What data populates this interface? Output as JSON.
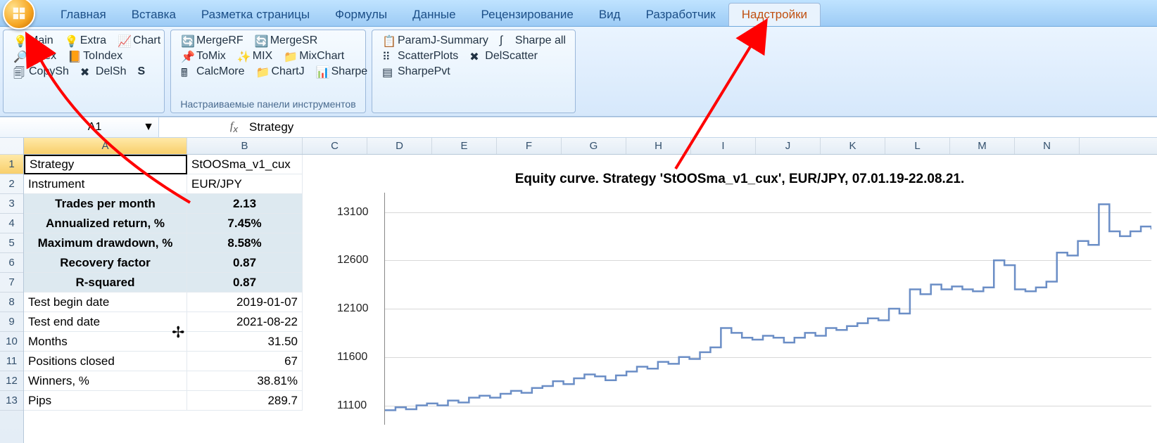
{
  "tabs": [
    "Главная",
    "Вставка",
    "Разметка страницы",
    "Формулы",
    "Данные",
    "Рецензирование",
    "Вид",
    "Разработчик",
    "Надстройки"
  ],
  "active_tab": 8,
  "ribbon": {
    "group1": {
      "items": [
        [
          "Main",
          "Extra",
          "Chart"
        ],
        [
          "Index",
          "ToIndex",
          ""
        ],
        [
          "CopySh",
          "DelSh",
          "S"
        ]
      ]
    },
    "group2": {
      "items": [
        [
          "MergeRF",
          "MergeSR",
          ""
        ],
        [
          "ToMix",
          "MIX",
          "MixChart"
        ],
        [
          "CalcMore",
          "ChartJ",
          "Sharpe"
        ]
      ]
    },
    "group3": {
      "items": [
        [
          "ParamJ-Summary",
          "Sharpe all"
        ],
        [
          "ScatterPlots",
          "DelScatter"
        ],
        [
          "SharpePvt",
          ""
        ]
      ]
    },
    "title": "Настраиваемые панели инструментов"
  },
  "namebox": "A1",
  "formula": "Strategy",
  "columns": [
    "A",
    "B",
    "C",
    "D",
    "E",
    "F",
    "G",
    "H",
    "I",
    "J",
    "K",
    "L",
    "M",
    "N"
  ],
  "rows": [
    {
      "a": "Strategy",
      "b": "StOOSma_v1_cux",
      "hl": false,
      "ra": false
    },
    {
      "a": "Instrument",
      "b": "EUR/JPY",
      "hl": false,
      "ra": false
    },
    {
      "a": "Trades per month",
      "b": "2.13",
      "hl": true
    },
    {
      "a": "Annualized return, %",
      "b": "7.45%",
      "hl": true
    },
    {
      "a": "Maximum drawdown, %",
      "b": "8.58%",
      "hl": true
    },
    {
      "a": "Recovery factor",
      "b": "0.87",
      "hl": true
    },
    {
      "a": "R-squared",
      "b": "0.87",
      "hl": true
    },
    {
      "a": "Test begin date",
      "b": "2019-01-07",
      "hl": false,
      "ra": true
    },
    {
      "a": "Test end date",
      "b": "2021-08-22",
      "hl": false,
      "ra": true
    },
    {
      "a": "Months",
      "b": "31.50",
      "hl": false,
      "ra": true
    },
    {
      "a": "Positions closed",
      "b": "67",
      "hl": false,
      "ra": true
    },
    {
      "a": "Winners, %",
      "b": "38.81%",
      "hl": false,
      "ra": true
    },
    {
      "a": "Pips",
      "b": "289.7",
      "hl": false,
      "ra": true
    }
  ],
  "chart_data": {
    "type": "line",
    "title": "Equity curve. Strategy 'StOOSma_v1_cux', EUR/JPY, 07.01.19-22.08.21.",
    "ylabel": "",
    "yticks": [
      11100,
      11600,
      12100,
      12600,
      13100
    ],
    "ylim": [
      10900,
      13300
    ],
    "x_range": [
      "2019-01-07",
      "2021-08-22"
    ],
    "values": [
      11050,
      11080,
      11060,
      11100,
      11120,
      11100,
      11150,
      11130,
      11180,
      11200,
      11180,
      11220,
      11250,
      11230,
      11280,
      11300,
      11350,
      11320,
      11380,
      11420,
      11400,
      11360,
      11410,
      11450,
      11500,
      11480,
      11550,
      11530,
      11600,
      11580,
      11650,
      11700,
      11900,
      11850,
      11800,
      11780,
      11820,
      11800,
      11750,
      11800,
      11850,
      11820,
      11900,
      11880,
      11920,
      11950,
      12000,
      11980,
      12100,
      12050,
      12300,
      12250,
      12350,
      12300,
      12330,
      12300,
      12280,
      12320,
      12600,
      12550,
      12300,
      12280,
      12320,
      12380,
      12680,
      12650,
      12800,
      12760,
      13180,
      12900,
      12850,
      12900,
      12950,
      12920
    ]
  }
}
